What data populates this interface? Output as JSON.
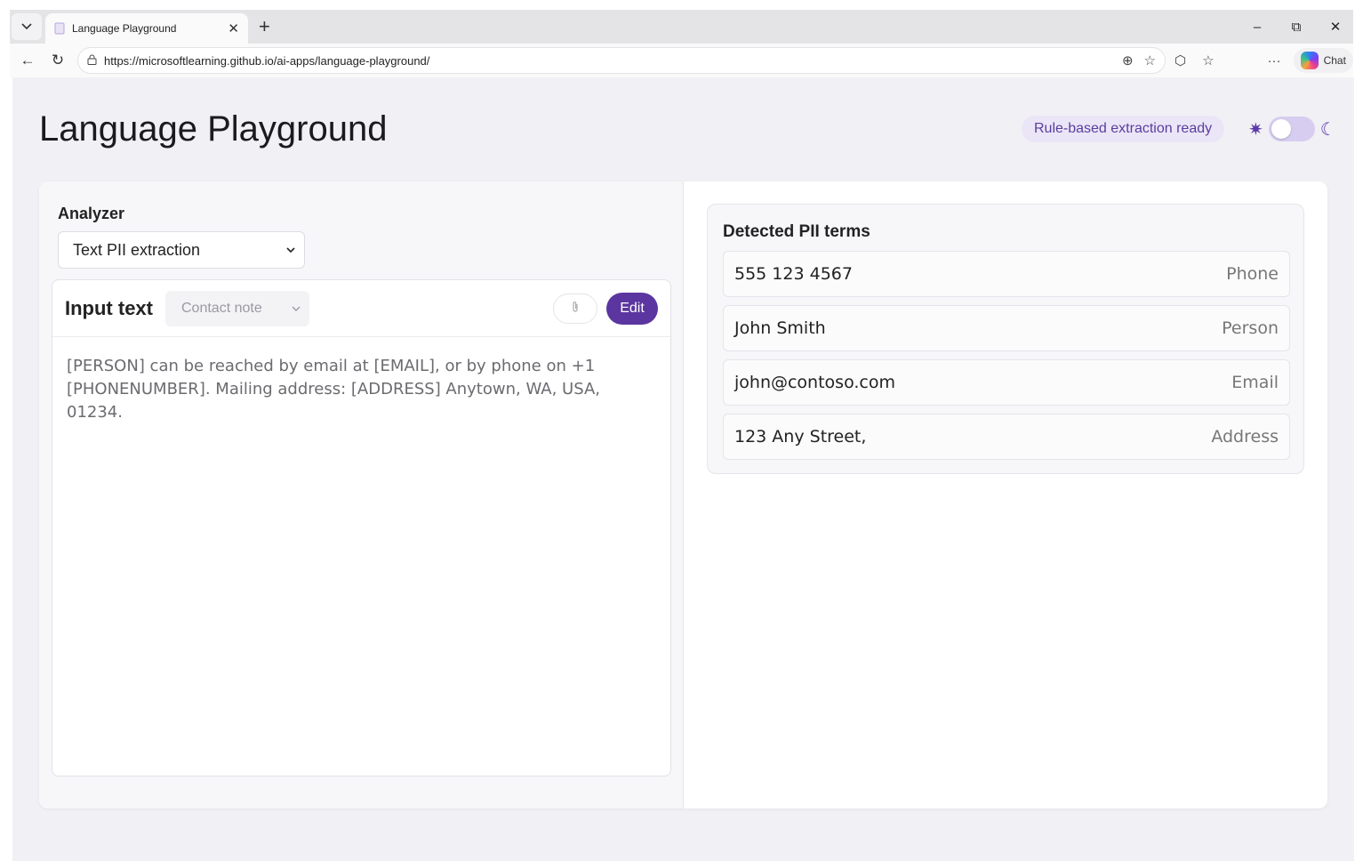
{
  "browser": {
    "tab_title": "Language Playground",
    "url": "https://microsoftlearning.github.io/ai-apps/language-playground/",
    "chat_label": "Chat"
  },
  "header": {
    "title": "Language Playground",
    "status": "Rule-based extraction ready"
  },
  "analyzer": {
    "label": "Analyzer",
    "selected": "Text PII extraction"
  },
  "input": {
    "title": "Input text",
    "sample_selected": "Contact note",
    "edit_label": "Edit",
    "text": "[PERSON] can be reached by email at [EMAIL], or by phone on +1 [PHONENUMBER]. Mailing address: [ADDRESS] Anytown, WA, USA, 01234."
  },
  "results": {
    "title": "Detected PII terms",
    "items": [
      {
        "term": "555 123 4567",
        "type": "Phone"
      },
      {
        "term": "John Smith",
        "type": "Person"
      },
      {
        "term": "john@contoso.com",
        "type": "Email"
      },
      {
        "term": "123 Any Street,",
        "type": "Address"
      }
    ]
  },
  "colors": {
    "accent": "#5b35a0",
    "page_bg": "#f1f0f5",
    "status_pill_bg": "#ebe6f7"
  }
}
